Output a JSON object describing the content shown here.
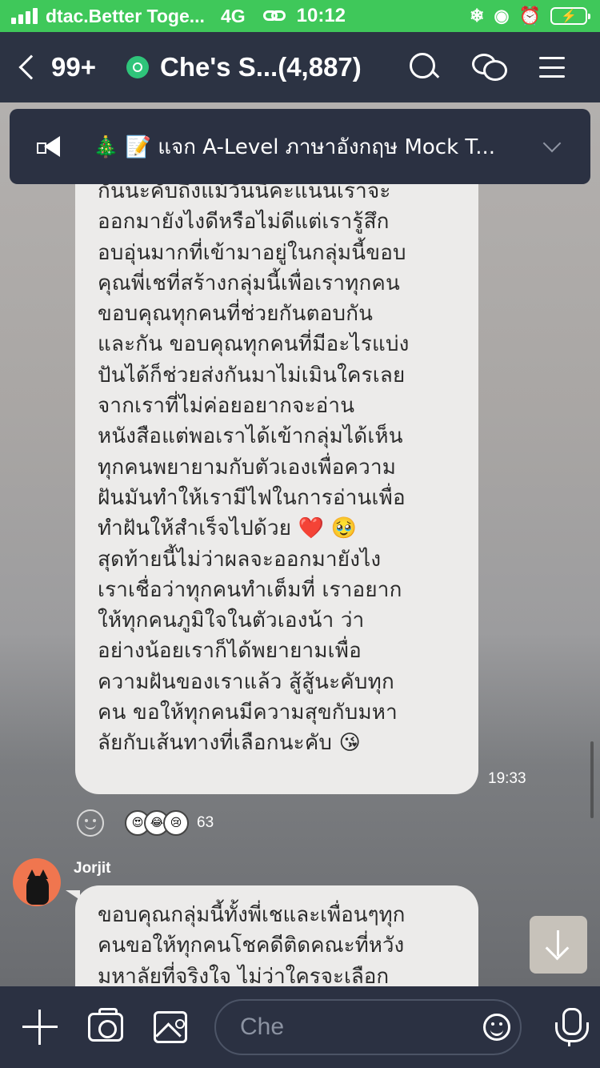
{
  "status_bar": {
    "carrier": "dtac.Better Toge...",
    "network": "4G",
    "time": "10:12"
  },
  "header": {
    "back_count": "99+",
    "title": "Che's S...(4,887)"
  },
  "announcement": {
    "text": "🎄 📝 แจก A-Level ภาษาอังกฤษ Mock T..."
  },
  "messages": [
    {
      "text": "กันนะคับถึงแม้วันนี้คะแนนเราจะ\nออกมายังไงดีหรือไม่ดีแต่เรารู้สึก\nอบอุ่นมากที่เข้ามาอยู่ในกลุ่มนี้ขอบ\nคุณพี่เชที่สร้างกลุ่มนี้เพื่อเราทุกคน\nขอบคุณทุกคนที่ช่วยกันตอบกัน\nและกัน ขอบคุณทุกคนที่มีอะไรแบ่ง\nปันได้ก็ช่วยส่งกันมาไม่เมินใครเลย\nจากเราที่ไม่ค่อยอยากจะอ่าน\nหนังสือแต่พอเราได้เข้ากลุ่มได้เห็น\nทุกคนพยายามกับตัวเองเพื่อความ\nฝันมันทำให้เรามีไฟในการอ่านเพื่อ\nทำฝันให้สำเร็จไปด้วย ❤️ 🥹\nสุดท้ายนี้ไม่ว่าผลจะออกมายังไง\nเราเชื่อว่าทุกคนทำเต็มที่ เราอยาก\nให้ทุกคนภูมิใจในตัวเองน้า ว่า\nอย่างน้อยเราก็ได้พยายามเพื่อ\nความฝันของเราแล้ว สู้สู้นะคับทุก\nคน ขอให้ทุกคนมีความสุขกับมหา\nลัยกับเส้นทางที่เลือกนะคับ 😘",
      "time": "19:33",
      "reaction_count": "63",
      "reactions": [
        "😍",
        "😂",
        "😢"
      ]
    },
    {
      "sender": "Jorjit",
      "text": "ขอบคุณกลุ่มนี้ทั้งพี่เชและเพื่อนๆทุก\nคนขอให้ทุกคนโชคดีติดคณะที่หวัง\nมหาลัยที่จริงใจ ไม่ว่าใครจะเลือก"
    }
  ],
  "composer": {
    "placeholder": "Che"
  }
}
